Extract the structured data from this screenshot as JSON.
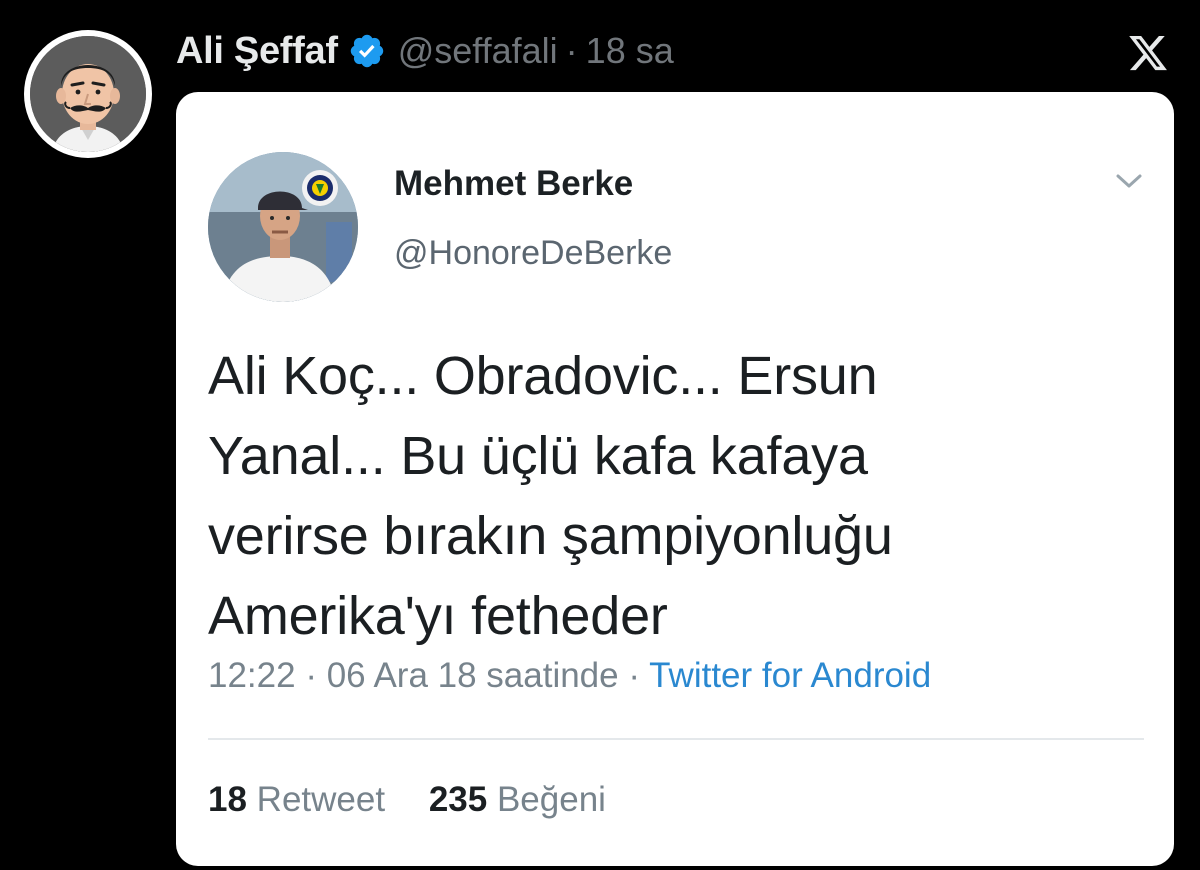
{
  "outer_tweet": {
    "author_name": "Ali Şeffaf",
    "handle": "@seffafali",
    "separator": "·",
    "time": "18 sa",
    "verified_icon": "verified-badge-icon",
    "platform_icon": "x-logo-icon"
  },
  "quoted_screenshot": {
    "author_name": "Mehmet Berke",
    "handle": "@HonoreDeBerke",
    "text_lines": [
      "Ali Koç... Obradovic... Ersun",
      "Yanal... Bu üçlü kafa kafaya",
      "verirse bırakın şampiyonluğu",
      "Amerika'yı fetheder"
    ],
    "time": "12:22",
    "date": "06 Ara 18 saatinde",
    "separator": "·",
    "source": "Twitter for Android",
    "retweets_count": "18",
    "retweets_label": "Retweet",
    "likes_count": "235",
    "likes_label": "Beğeni"
  },
  "colors": {
    "background": "#000000",
    "card": "#ffffff",
    "verified_blue": "#1d9bf0",
    "link_blue": "#2a88d0",
    "muted_text": "#71767b"
  }
}
